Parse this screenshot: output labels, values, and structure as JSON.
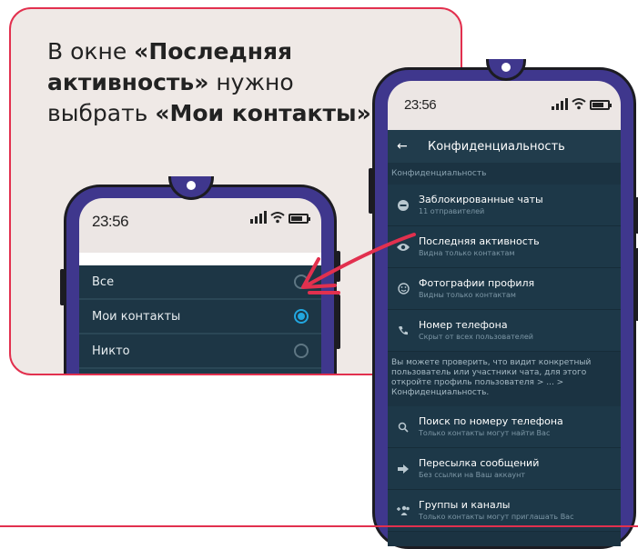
{
  "headline": {
    "line1_pre": "В окне ",
    "line1_bold": "«Последняя",
    "line2_bold": "активность»",
    "line2_post": " нужно",
    "line3_pre": "выбрать ",
    "line3_bold": "«Мои контакты»"
  },
  "small_phone": {
    "time": "23:56",
    "options": [
      {
        "label": "Все",
        "selected": false
      },
      {
        "label": "Мои контакты",
        "selected": true
      },
      {
        "label": "Никто",
        "selected": false
      }
    ]
  },
  "big_phone": {
    "time": "23:56",
    "appbar_title": "Конфиденциальность",
    "section_title": "Конфиденциальность",
    "items": [
      {
        "icon": "minus-circle-icon",
        "title": "Заблокированные чаты",
        "subtitle": "11 отправителей"
      },
      {
        "icon": "eye-icon",
        "title": "Последняя активность",
        "subtitle": "Видна только контактам"
      },
      {
        "icon": "smiley-icon",
        "title": "Фотографии профиля",
        "subtitle": "Видны только контактам"
      },
      {
        "icon": "phone-icon",
        "title": "Номер телефона",
        "subtitle": "Скрыт от всех пользователей"
      }
    ],
    "info_text": "Вы можете проверить, что видит конкретный пользователь или участники чата, для этого откройте профиль пользователя > ... > Конфиденциальность.",
    "items2": [
      {
        "icon": "search-icon",
        "title": "Поиск по номеру телефона",
        "subtitle": "Только контакты могут найти Вас"
      },
      {
        "icon": "forward-arrow-icon",
        "title": "Пересылка сообщений",
        "subtitle": "Без ссылки на Ваш аккаунт"
      },
      {
        "icon": "add-group-icon",
        "title": "Группы и каналы",
        "subtitle": "Только контакты могут приглашать Вас"
      }
    ]
  },
  "colors": {
    "accent": "#e2304e",
    "phone_frame": "#3f378d",
    "screen_bg": "#1b3342",
    "radio_active": "#22a7e0"
  }
}
